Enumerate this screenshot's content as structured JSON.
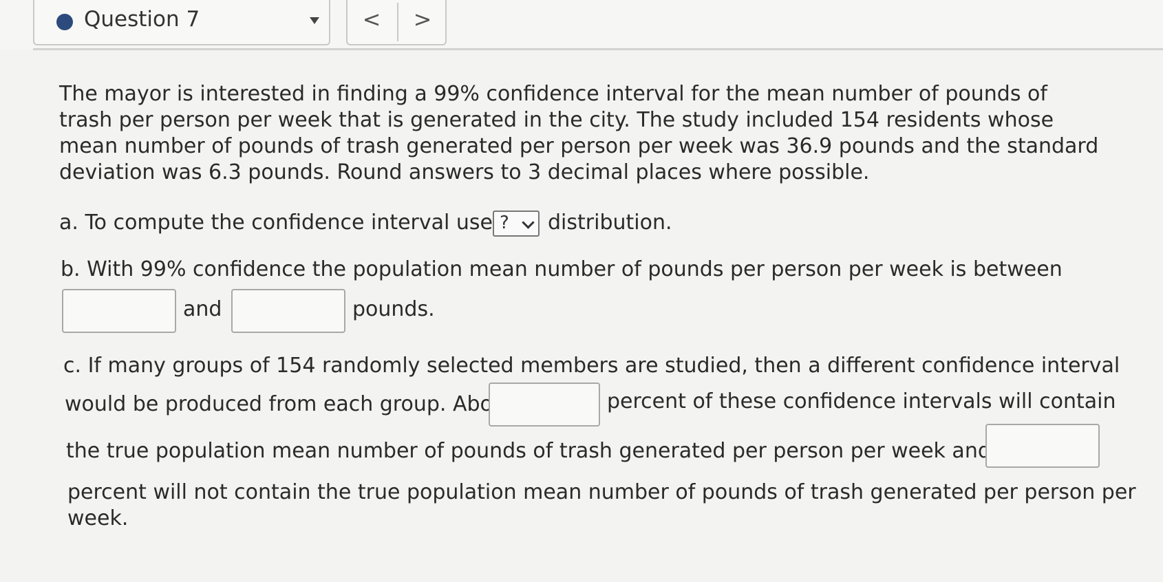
{
  "header": {
    "question_label": "Question 7",
    "prev_label": "<",
    "next_label": ">"
  },
  "question": {
    "intro": "The mayor is interested in finding a 99% confidence interval for the mean number of pounds of trash per person per week that is generated in the city. The study included 154 residents whose mean number of pounds of trash generated per person per week was 36.9 pounds and the standard deviation was 6.3 pounds. Round answers to 3 decimal places where possible.",
    "part_a_before": "a. To compute the confidence interval use a",
    "part_a_dropdown": "?",
    "part_a_after": "distribution.",
    "part_b_line1": "b. With 99% confidence the population mean number of pounds per person per week is between",
    "part_b_and": "and",
    "part_b_pounds": "pounds.",
    "part_c_line1": "c. If many groups of 154 randomly selected members are studied, then a different confidence interval",
    "part_c_line2a": "would be produced from each group. About",
    "part_c_line2b": "percent of these confidence intervals will contain",
    "part_c_line3": "the true population mean number of pounds of trash generated per person per week and about",
    "part_c_line4": "percent will not contain the true population mean number of pounds of trash generated per person per",
    "part_c_line5": "week."
  }
}
